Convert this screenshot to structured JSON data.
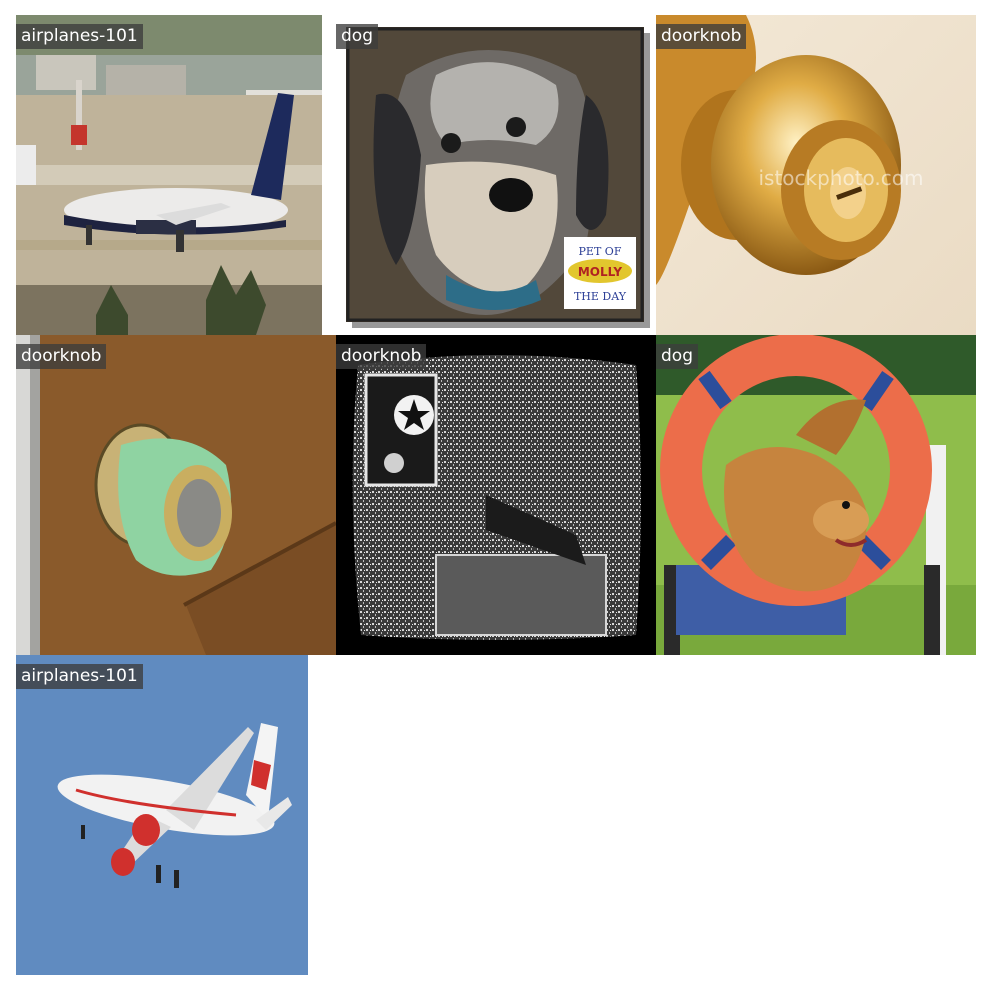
{
  "gallery": {
    "tiles": [
      {
        "label": "airplanes-101",
        "image": "airliner-on-runway"
      },
      {
        "label": "dog",
        "image": "shaggy-dog-portrait",
        "badge": {
          "line1": "PET OF",
          "line2": "MOLLY",
          "line3": "THE DAY"
        }
      },
      {
        "label": "doorknob",
        "image": "brass-doorknob",
        "watermark": "istockphoto.com"
      },
      {
        "label": "doorknob",
        "image": "green-doorknob-on-wood"
      },
      {
        "label": "doorknob",
        "image": "black-white-door"
      },
      {
        "label": "dog",
        "image": "dog-jumping-through-ring"
      },
      {
        "label": "airplanes-101",
        "image": "airliner-in-sky"
      }
    ]
  },
  "colors": {
    "label_bg": "#3c3c3c",
    "label_text": "#ffffff",
    "page_bg": "#ffffff"
  }
}
